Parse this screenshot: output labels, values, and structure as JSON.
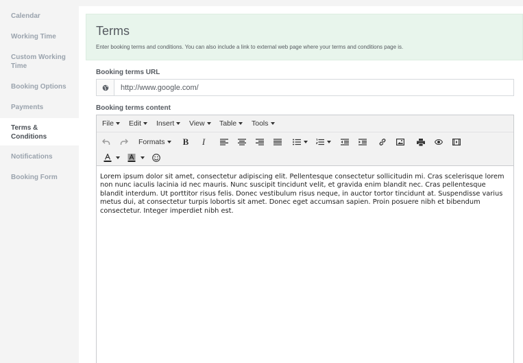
{
  "sidebar": {
    "items": [
      {
        "label": "Calendar"
      },
      {
        "label": "Working Time"
      },
      {
        "label": "Custom Working Time"
      },
      {
        "label": "Booking Options"
      },
      {
        "label": "Payments"
      },
      {
        "label": "Terms & Conditions",
        "active": true
      },
      {
        "label": "Notifications"
      },
      {
        "label": "Booking Form"
      }
    ]
  },
  "header": {
    "title": "Terms",
    "description": "Enter booking terms and conditions. You can also include a link to external web page where your terms and conditions page is."
  },
  "url_field": {
    "label": "Booking terms URL",
    "value": "http://www.google.com/",
    "icon": "globe-icon"
  },
  "content_field": {
    "label": "Booking terms content"
  },
  "editor": {
    "menus": [
      "File",
      "Edit",
      "Insert",
      "View",
      "Table",
      "Tools"
    ],
    "formats_label": "Formats",
    "content": "Lorem ipsum dolor sit amet, consectetur adipiscing elit. Pellentesque consectetur sollicitudin mi. Cras scelerisque lorem non nunc iaculis lacinia id nec mauris. Nunc suscipit tincidunt velit, et gravida enim blandit nec. Cras pellentesque blandit interdum. Ut porttitor risus felis. Donec vestibulum risus neque, in auctor tortor tincidunt at. Suspendisse varius metus dui, at consectetur turpis lobortis sit amet. Donec eget accumsan sapien. Proin posuere nibh et bibendum consectetur. Integer imperdiet nibh est."
  },
  "colors": {
    "header_bg": "#e8f5ec",
    "sidebar_bg": "#f4f4f4",
    "sidebar_text": "#9aa3ad",
    "active_text": "#4a4f55"
  }
}
